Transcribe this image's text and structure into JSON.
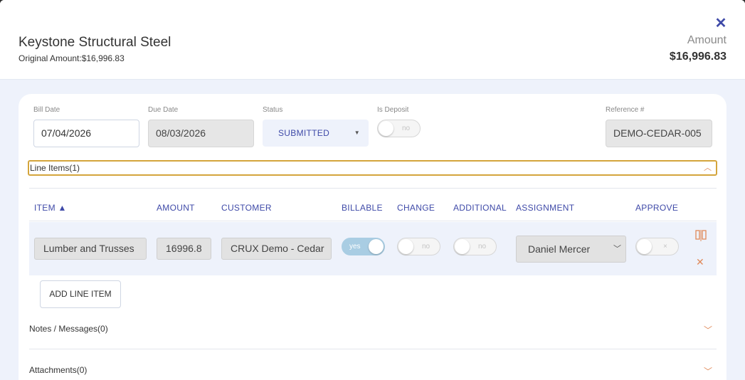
{
  "header": {
    "vendor_name": "Keystone Structural Steel",
    "original_amount": "Original Amount:$16,996.83",
    "amount_label": "Amount",
    "amount_value": "$16,996.83",
    "close_icon": "close-icon"
  },
  "form": {
    "bill_date_label": "Bill Date",
    "bill_date_value": "07/04/2026",
    "due_date_label": "Due Date",
    "due_date_value": "08/03/2026",
    "status_label": "Status",
    "status_value": "SUBMITTED",
    "is_deposit_label": "Is Deposit",
    "is_deposit_value": "no",
    "reference_label": "Reference #",
    "reference_value": "DEMO-CEDAR-005"
  },
  "line_items": {
    "title": "Line Items(1)",
    "columns": [
      "ITEM ▲",
      "AMOUNT",
      "CUSTOMER",
      "BILLABLE",
      "CHANGE",
      "ADDITIONAL",
      "ASSIGNMENT",
      "APPROVE"
    ],
    "rows": [
      {
        "item": "Lumber and Trusses",
        "amount": "16996.8",
        "customer": "CRUX Demo - Cedar",
        "billable": "yes",
        "change": "no",
        "additional": "no",
        "assignment": "Daniel Mercer",
        "approve": "×"
      }
    ],
    "add_button": "ADD LINE ITEM"
  },
  "sections": {
    "notes": "Notes / Messages(0)",
    "attachments": "Attachments(0)"
  },
  "colors": {
    "accent": "#3f4aa8",
    "orange": "#e08a5a",
    "highlight_border": "#d4a53c",
    "toggle_on": "#a9cde3"
  }
}
